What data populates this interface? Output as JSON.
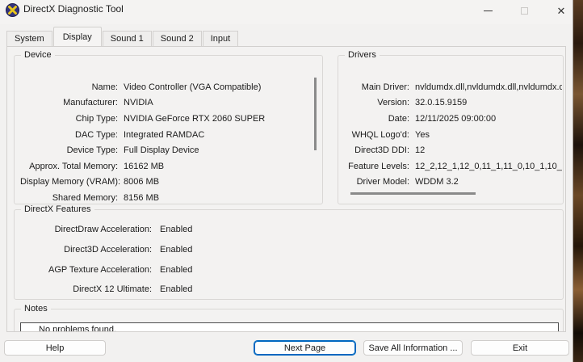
{
  "window": {
    "title": "DirectX Diagnostic Tool",
    "titlebar": {
      "close_glyph": "✕"
    }
  },
  "tabs": [
    {
      "label": "System"
    },
    {
      "label": "Display"
    },
    {
      "label": "Sound 1"
    },
    {
      "label": "Sound 2"
    },
    {
      "label": "Input"
    }
  ],
  "active_tab": "Display",
  "device": {
    "title": "Device",
    "rows": [
      {
        "label": "Name:",
        "value": "Video Controller (VGA Compatible)"
      },
      {
        "label": "Manufacturer:",
        "value": "NVIDIA"
      },
      {
        "label": "Chip Type:",
        "value": "NVIDIA GeForce RTX 2060 SUPER"
      },
      {
        "label": "DAC Type:",
        "value": "Integrated RAMDAC"
      },
      {
        "label": "Device Type:",
        "value": "Full Display Device"
      },
      {
        "label": "Approx. Total Memory:",
        "value": "16162 MB"
      },
      {
        "label": "Display Memory (VRAM):",
        "value": "8006 MB"
      },
      {
        "label": "Shared Memory:",
        "value": "8156 MB"
      }
    ]
  },
  "drivers": {
    "title": "Drivers",
    "rows": [
      {
        "label": "Main Driver:",
        "value": "nvldumdx.dll,nvldumdx.dll,nvldumdx.d"
      },
      {
        "label": "Version:",
        "value": "32.0.15.9159"
      },
      {
        "label": "Date:",
        "value": "12/11/2025 09:00:00"
      },
      {
        "label": "WHQL Logo'd:",
        "value": "Yes"
      },
      {
        "label": "Direct3D DDI:",
        "value": "12"
      },
      {
        "label": "Feature Levels:",
        "value": "12_2,12_1,12_0,11_1,11_0,10_1,10_"
      },
      {
        "label": "Driver Model:",
        "value": "WDDM 3.2"
      }
    ]
  },
  "features": {
    "title": "DirectX Features",
    "rows": [
      {
        "label": "DirectDraw Acceleration:",
        "value": "Enabled"
      },
      {
        "label": "Direct3D Acceleration:",
        "value": "Enabled"
      },
      {
        "label": "AGP Texture Acceleration:",
        "value": "Enabled"
      },
      {
        "label": "DirectX 12 Ultimate:",
        "value": "Enabled"
      }
    ]
  },
  "notes": {
    "title": "Notes",
    "text": "No problems found."
  },
  "buttons": {
    "help": "Help",
    "next_page": "Next Page",
    "save_all": "Save All Information ...",
    "exit": "Exit"
  },
  "colors": {
    "accent_focus": "#0067c0",
    "scrollbar_thumb": "#8a8a8a",
    "dialog_bg": "#f2f1f0",
    "notes_border": "#4d4d4d",
    "wallpaper_brown": "#5a3c22"
  }
}
